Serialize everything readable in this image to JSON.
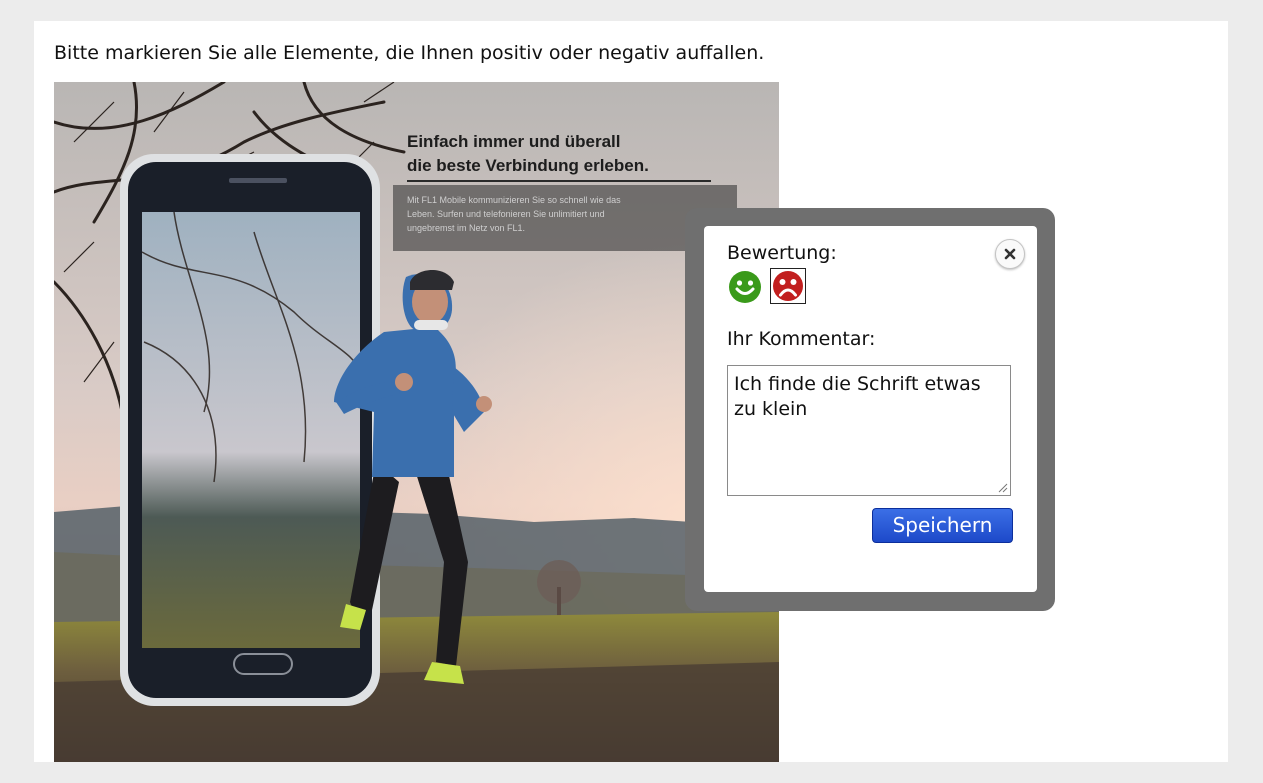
{
  "instruction": "Bitte markieren Sie alle Elemente, die Ihnen positiv oder negativ auffallen.",
  "ad": {
    "headline_line1": "Einfach immer und überall",
    "headline_line2": "die beste Verbindung erleben.",
    "body_line1": "Mit FL1 Mobile kommunizieren Sie so schnell wie das",
    "body_line2": "Leben. Surfen und telefonieren Sie unlimitiert und",
    "body_line3": "ungebremst im Netz von FL1."
  },
  "popup": {
    "rating_label": "Bewertung:",
    "comment_label": "Ihr Kommentar:",
    "comment_value": "Ich finde die Schrift etwas zu klein",
    "save_label": "Speichern"
  },
  "colors": {
    "positive": "#3a9a1a",
    "negative": "#c21f1f",
    "save_button": "#2452d6",
    "popup_frame": "#6f6f6f"
  },
  "icons": {
    "close": "close-icon",
    "positive": "smiley-positive-icon",
    "negative": "smiley-negative-icon"
  }
}
